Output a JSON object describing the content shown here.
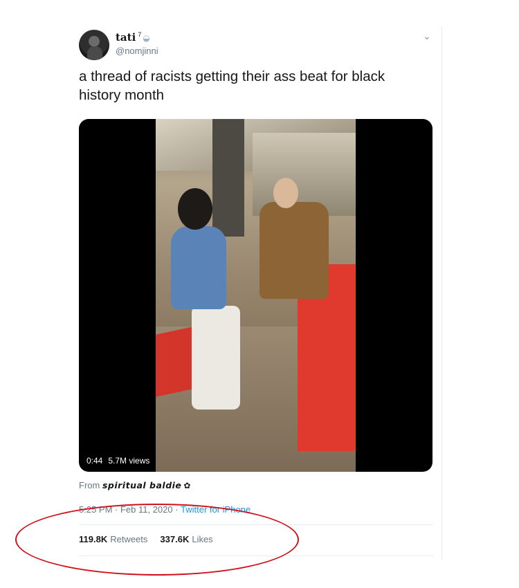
{
  "author": {
    "display_name": "tati",
    "name_superscript": "7",
    "handle": "@nomjinni"
  },
  "tweet": {
    "text": "a thread of racists getting their ass beat for black history month"
  },
  "video": {
    "duration": "0:44",
    "views": "5.7M views"
  },
  "source": {
    "prefix": "From",
    "name": "spiritual baldie",
    "name_glyph": "✿"
  },
  "meta": {
    "timestamp": "5:25 PM · Feb 11, 2020",
    "separator": "·",
    "client": "Twitter for iPhone"
  },
  "stats": {
    "retweets_count": "119.8K",
    "retweets_label": "Retweets",
    "likes_count": "337.6K",
    "likes_label": "Likes"
  },
  "icons": {
    "menu": "chevron-down-icon",
    "name_emoji": "swan-icon"
  },
  "colors": {
    "link": "#1b95e0",
    "annotation": "#d0101a"
  }
}
